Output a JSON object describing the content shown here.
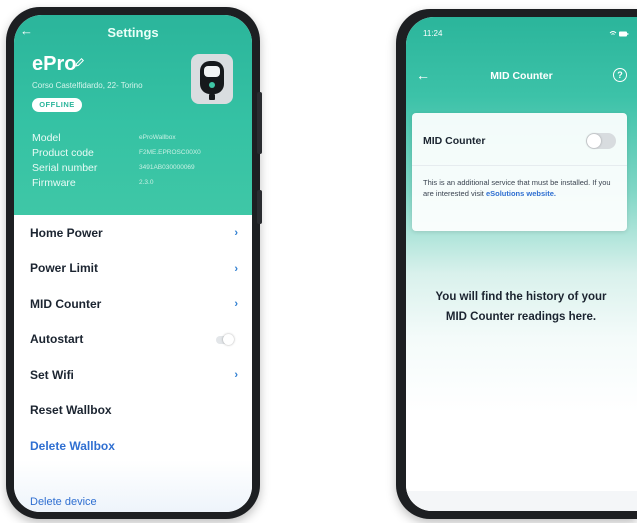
{
  "left_phone": {
    "header": {
      "back_icon": "arrow-left-icon",
      "title": "Settings",
      "device_name": "ePro",
      "edit_icon": "pencil-icon",
      "address": "Corso Castelfidardo, 22- Torino",
      "status_badge": "OFFLINE",
      "device_image_icon": "wallbox-icon"
    },
    "info": [
      {
        "label": "Model",
        "value": "eProWallbox"
      },
      {
        "label": "Product code",
        "value": "F2ME.EPROSC00X0"
      },
      {
        "label": "Serial number",
        "value": "3491AB030000069"
      },
      {
        "label": "Firmware",
        "value": "2.3.0"
      }
    ],
    "menu": [
      {
        "label": "Home Power",
        "control": "chevron"
      },
      {
        "label": "Power Limit",
        "control": "chevron"
      },
      {
        "label": "MID Counter",
        "control": "chevron"
      },
      {
        "label": "Autostart",
        "control": "toggle",
        "toggle_on": false
      },
      {
        "label": "Set Wifi",
        "control": "chevron"
      },
      {
        "label": "Reset Wallbox",
        "control": "none"
      },
      {
        "label": "Delete Wallbox",
        "control": "none",
        "style": "danger"
      }
    ],
    "footer_link": "Delete device"
  },
  "right_phone": {
    "status_bar": {
      "time": "11:24",
      "icons": [
        "location-icon",
        "wifi-icon",
        "battery-icon"
      ]
    },
    "nav": {
      "back_icon": "arrow-left-icon",
      "title": "MID Counter",
      "help_icon": "help-circle-icon",
      "help_glyph": "?"
    },
    "card": {
      "title": "MID Counter",
      "switch_on": false,
      "description": "This is an additional service that must be installed. If you are interested visit",
      "link_text": "eSolutions website."
    },
    "empty_state": "You will find the history of your MID Counter readings here."
  },
  "colors": {
    "teal": "#2bb59b",
    "teal_light": "#3fc7a6",
    "link_blue": "#2f6fd1",
    "text_dark": "#1b2430",
    "phone_frame": "#1d1f22"
  }
}
